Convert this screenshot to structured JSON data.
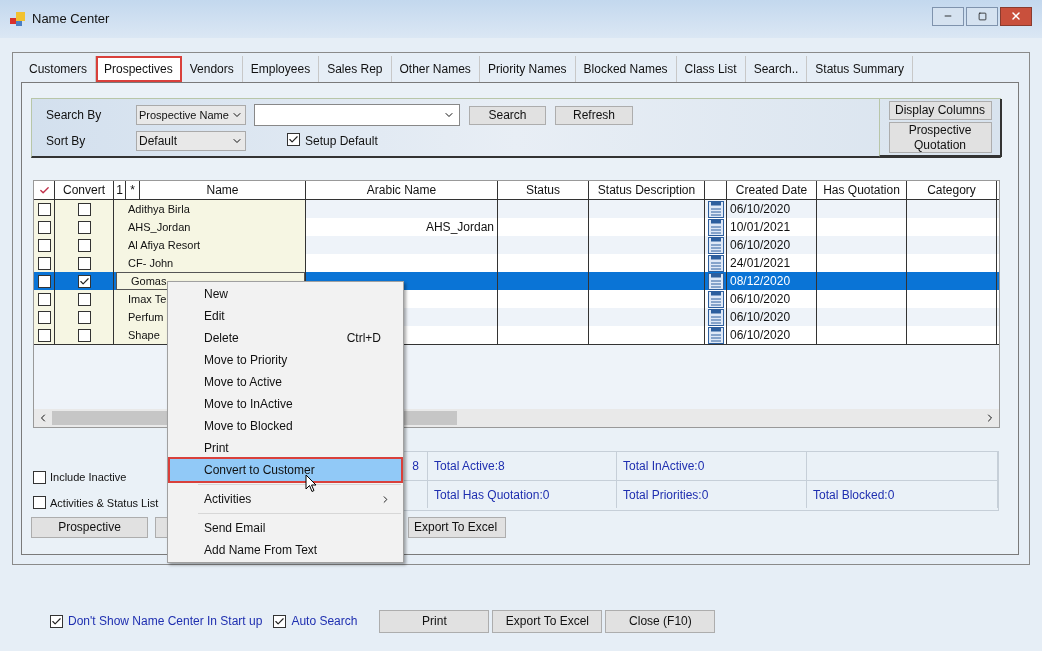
{
  "window": {
    "title": "Name Center"
  },
  "tabs": [
    {
      "label": "Customers",
      "selected": false,
      "annotated": false
    },
    {
      "label": "Prospectives",
      "selected": true,
      "annotated": true
    },
    {
      "label": "Vendors",
      "selected": false,
      "annotated": false
    },
    {
      "label": "Employees",
      "selected": false,
      "annotated": false
    },
    {
      "label": "Sales Rep",
      "selected": false,
      "annotated": false
    },
    {
      "label": "Other Names",
      "selected": false,
      "annotated": false
    },
    {
      "label": "Priority Names",
      "selected": false,
      "annotated": false
    },
    {
      "label": "Blocked Names",
      "selected": false,
      "annotated": false
    },
    {
      "label": "Class List",
      "selected": false,
      "annotated": false
    },
    {
      "label": "Search..",
      "selected": false,
      "annotated": false
    },
    {
      "label": "Status Summary",
      "selected": false,
      "annotated": false
    }
  ],
  "search": {
    "search_by_label": "Search By",
    "search_by_value": "Prospective Name",
    "sort_by_label": "Sort By",
    "sort_by_value": "Default",
    "setup_default": {
      "label": "Setup Default",
      "checked": true
    },
    "search_button": "Search",
    "refresh_button": "Refresh",
    "display_columns_button": "Display Columns",
    "prospective_quotation_button": "Prospective Quotation"
  },
  "table": {
    "columns": [
      "Convert",
      "1",
      "*",
      "Name",
      "Arabic Name",
      "Status",
      "Status Description",
      "Created Date",
      "Has Quotation",
      "Category"
    ],
    "rows": [
      {
        "checked": false,
        "convert": false,
        "name": "Adithya Birla",
        "created_date": "06/10/2020",
        "selected": false
      },
      {
        "checked": false,
        "convert": false,
        "name": "AHS_Jordan",
        "arabic_name": "AHS_Jordan",
        "created_date": "10/01/2021",
        "selected": false
      },
      {
        "checked": false,
        "convert": false,
        "name": "Al Afiya Resort",
        "created_date": "06/10/2020",
        "selected": false
      },
      {
        "checked": false,
        "convert": false,
        "name": "CF- John",
        "created_date": "24/01/2021",
        "selected": false
      },
      {
        "checked": false,
        "convert": true,
        "name": "Gomas",
        "created_date": "08/12/2020",
        "selected": true
      },
      {
        "checked": false,
        "convert": false,
        "name": "Imax Te",
        "created_date": "06/10/2020",
        "selected": false
      },
      {
        "checked": false,
        "convert": false,
        "name": "Perfum",
        "created_date": "06/10/2020",
        "selected": false
      },
      {
        "checked": false,
        "convert": false,
        "name": "Shape",
        "created_date": "06/10/2020",
        "selected": false
      }
    ]
  },
  "options": [
    {
      "label": "Include Inactive",
      "checked": false
    },
    {
      "label": "Activities & Status List",
      "checked": false
    }
  ],
  "totals": {
    "row_1": [
      "8",
      "Total Active:8",
      "Total InActive:0"
    ],
    "row_2": [
      "Total Has Quotation:0",
      "Total Priorities:0",
      "Total Blocked:0"
    ]
  },
  "panel_buttons": [
    "Prospective",
    "Export To Excel"
  ],
  "context_menu": [
    {
      "kind": "item",
      "label": "New",
      "selected": false,
      "annotated": false
    },
    {
      "kind": "item",
      "label": "Edit",
      "selected": false,
      "annotated": false
    },
    {
      "kind": "item",
      "label": "Delete",
      "shortcut": "Ctrl+D",
      "selected": false,
      "annotated": false
    },
    {
      "kind": "item",
      "label": "Move to Priority",
      "selected": false,
      "annotated": false
    },
    {
      "kind": "item",
      "label": "Move to Active",
      "selected": false,
      "annotated": false
    },
    {
      "kind": "item",
      "label": "Move to InActive",
      "selected": false,
      "annotated": false
    },
    {
      "kind": "item",
      "label": "Move to Blocked",
      "selected": false,
      "annotated": false
    },
    {
      "kind": "item",
      "label": "Print",
      "selected": false,
      "annotated": false
    },
    {
      "kind": "item",
      "label": "Convert to Customer",
      "selected": true,
      "annotated": true
    },
    {
      "kind": "separator"
    },
    {
      "kind": "submenu",
      "label": "Activities",
      "selected": false,
      "annotated": false
    },
    {
      "kind": "separator"
    },
    {
      "kind": "item",
      "label": "Send Email",
      "selected": false,
      "annotated": false
    },
    {
      "kind": "item",
      "label": "Add Name From Text",
      "selected": false,
      "annotated": false
    }
  ],
  "footer": {
    "options": [
      {
        "label": "Don't Show Name Center In Start up",
        "checked": true
      },
      {
        "label": "Auto Search",
        "checked": true
      }
    ],
    "buttons": [
      "Print",
      "Export To Excel",
      "Close (F10)"
    ]
  }
}
